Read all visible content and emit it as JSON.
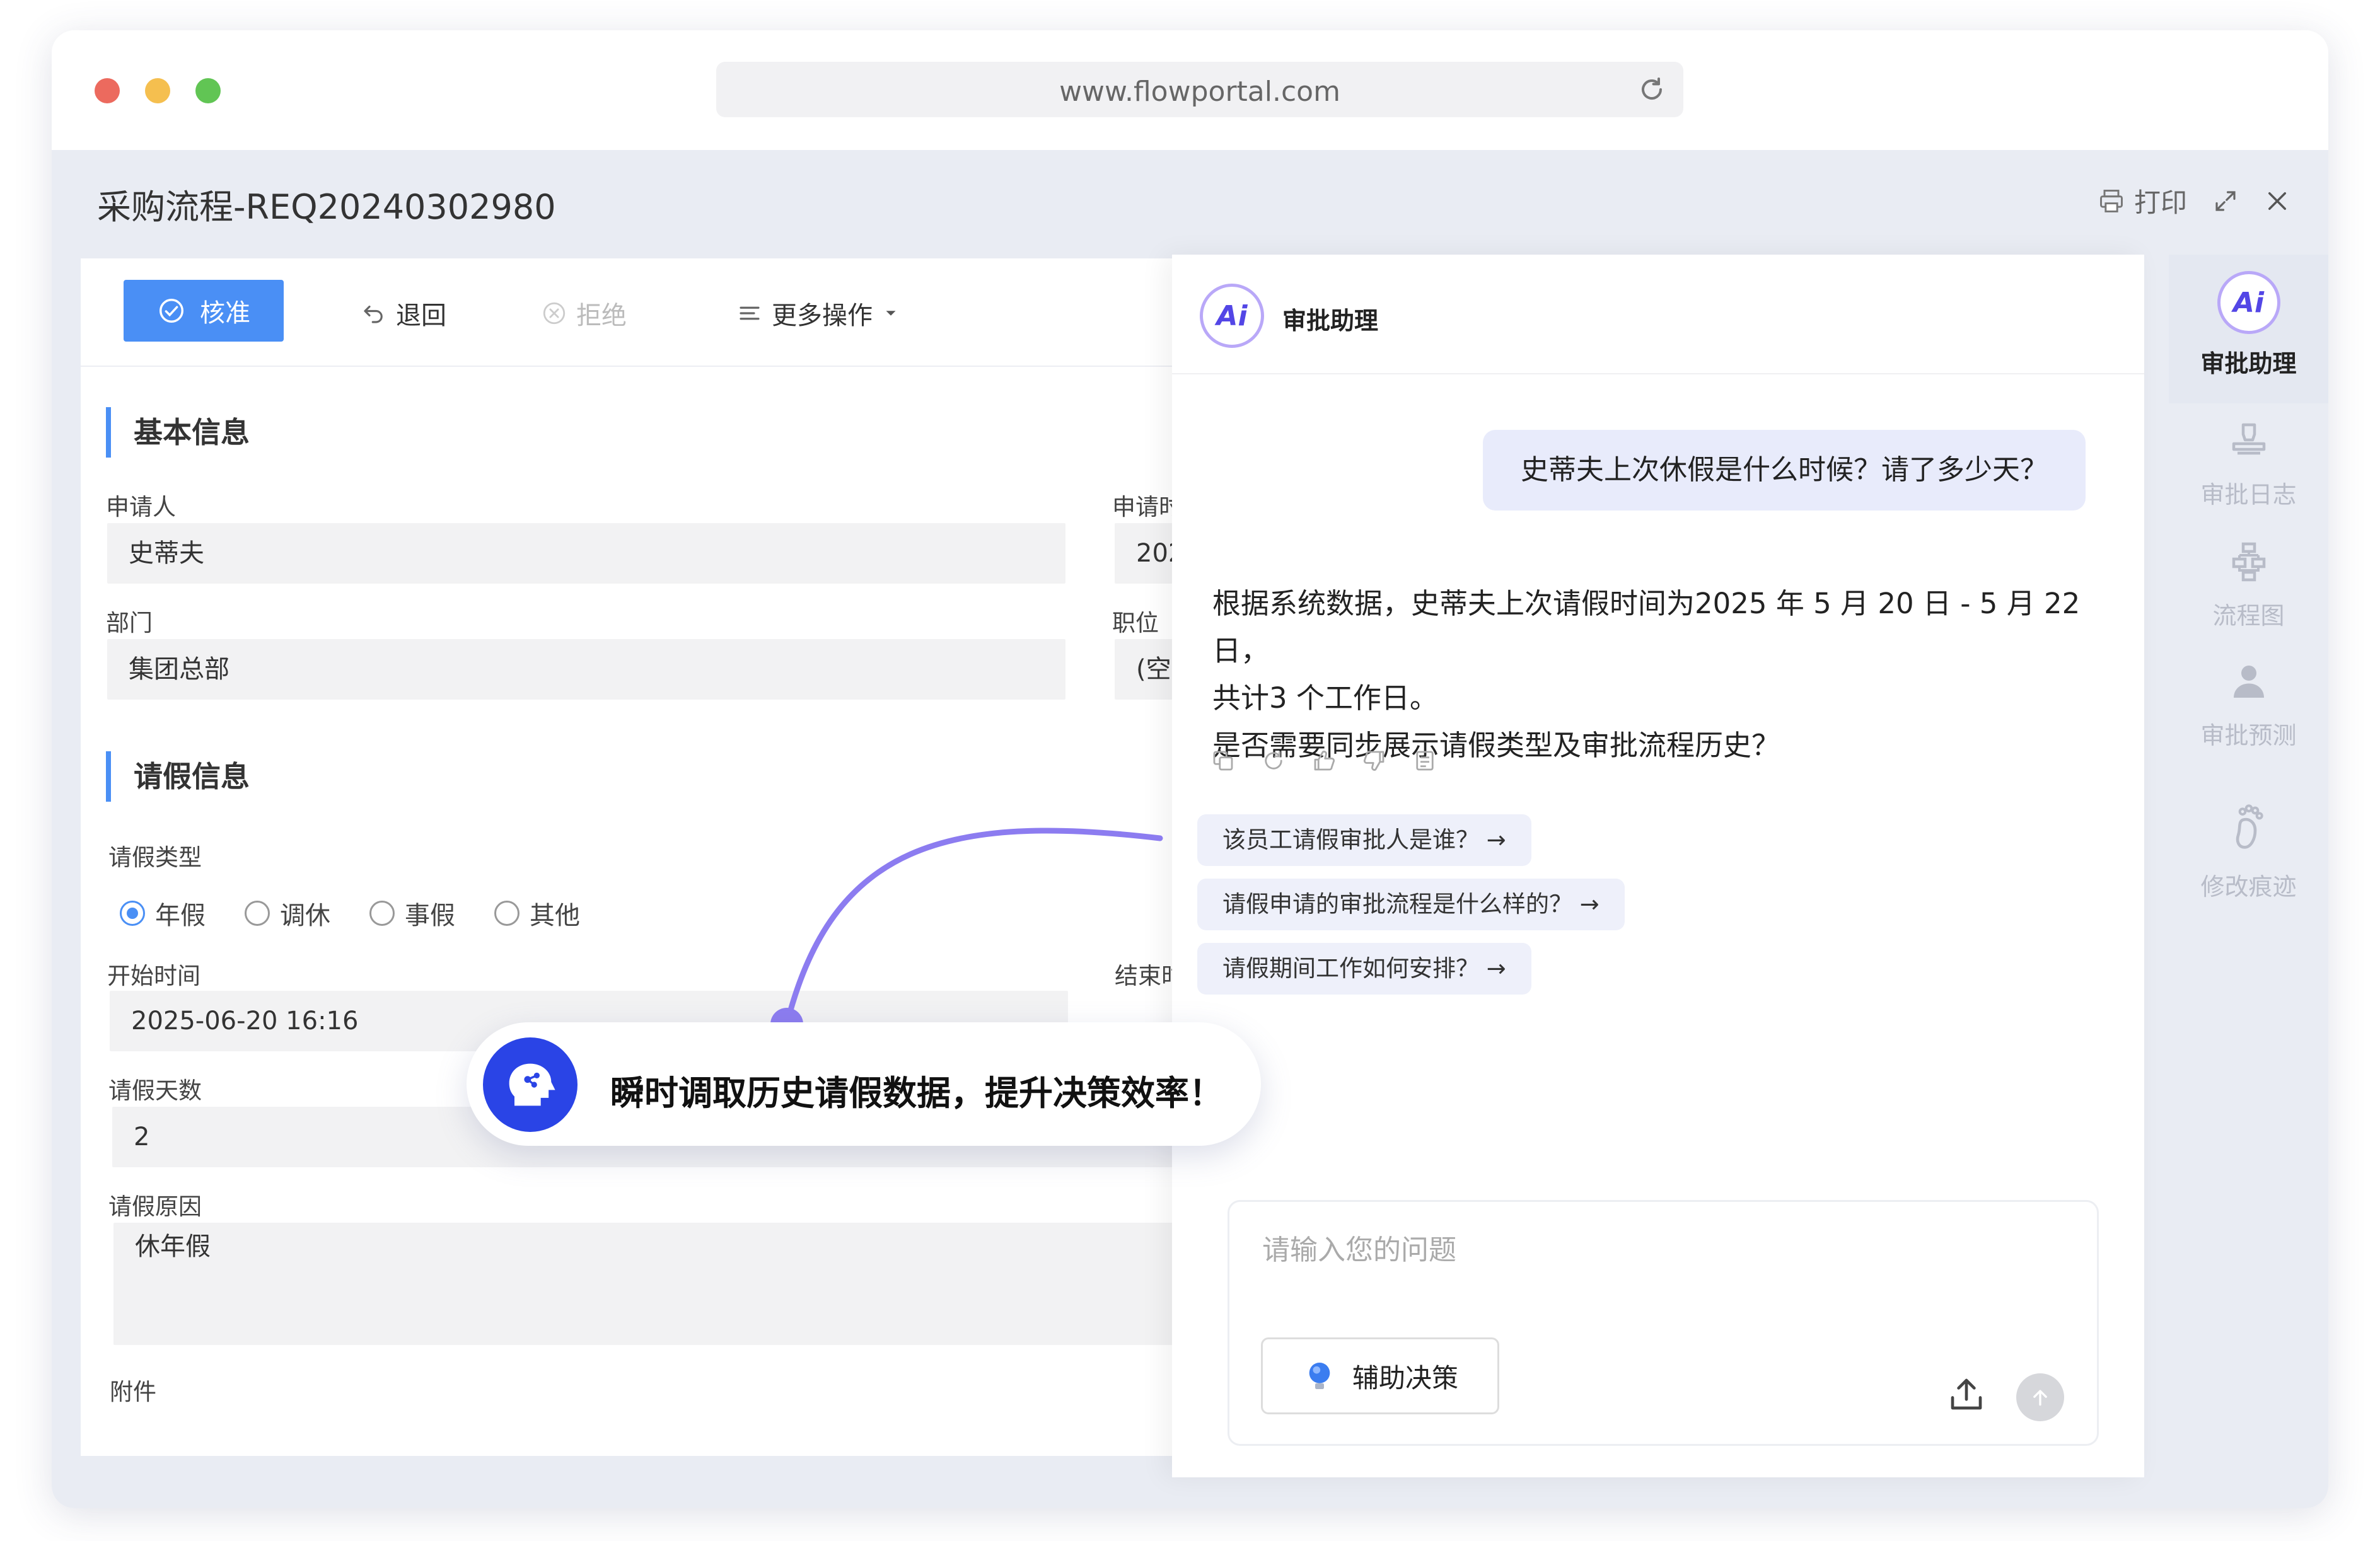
{
  "browser": {
    "url": "www.flowportal.com",
    "icons": {
      "reload": "reload-icon"
    }
  },
  "header": {
    "title": "采购流程-REQ20240302980",
    "print_label": "打印",
    "icons": {
      "print": "printer-icon",
      "expand": "expand-icon",
      "close": "close-icon"
    }
  },
  "toolbar": {
    "approve_label": "核准",
    "return_label": "退回",
    "reject_label": "拒绝",
    "more_label": "更多操作"
  },
  "basic_info": {
    "section_title": "基本信息",
    "applicant_label": "申请人",
    "applicant_value": "史蒂夫",
    "apply_date_label": "申请时",
    "apply_date_value": "202",
    "department_label": "部门",
    "department_value": "集团总部",
    "position_label": "职位",
    "position_value": "(空)"
  },
  "leave_info": {
    "section_title": "请假信息",
    "type_label": "请假类型",
    "types": [
      {
        "label": "年假",
        "selected": true
      },
      {
        "label": "调休",
        "selected": false
      },
      {
        "label": "事假",
        "selected": false
      },
      {
        "label": "其他",
        "selected": false
      }
    ],
    "start_label": "开始时间",
    "start_value": "2025-06-20 16:16",
    "end_label": "结束时",
    "days_label": "请假天数",
    "days_value": "2",
    "reason_label": "请假原因",
    "reason_value": "休年假",
    "attachment_label": "附件"
  },
  "chat": {
    "title": "审批助理",
    "badge": "Ai",
    "user_message": "史蒂夫上次休假是什么时候？请了多少天？",
    "answer_lines": [
      "根据系统数据，史蒂夫上次请假时间为2025 年 5 月 20 日 - 5 月 22 日，",
      "共计3 个工作日。",
      "是否需要同步展示请假类型及审批流程历史？"
    ],
    "message_actions": [
      "copy-icon",
      "refresh-icon",
      "thumbs-up-icon",
      "thumbs-down-icon",
      "note-icon"
    ],
    "suggestions": [
      "该员工请假审批人是谁？ →",
      "请假申请的审批流程是什么样的？ →",
      "请假期间工作如何安排？ →"
    ],
    "input_placeholder": "请输入您的问题",
    "assist_label": "辅助决策"
  },
  "rail": {
    "items": [
      {
        "label": "审批助理",
        "icon": "ai-badge-icon",
        "active": true
      },
      {
        "label": "审批日志",
        "icon": "stamp-icon",
        "active": false
      },
      {
        "label": "流程图",
        "icon": "flowchart-icon",
        "active": false
      },
      {
        "label": "审批预测",
        "icon": "person-icon",
        "active": false
      },
      {
        "label": "修改痕迹",
        "icon": "footprint-icon",
        "active": false
      }
    ]
  },
  "callout": {
    "text": "瞬时调取历史请假数据，提升决策效率！",
    "icon": "brain-head-icon"
  },
  "colors": {
    "accent": "#4a8ff5",
    "ai_purple": "#5346e6",
    "callout_blue": "#2a44e6",
    "connector": "#8c7cf0"
  }
}
